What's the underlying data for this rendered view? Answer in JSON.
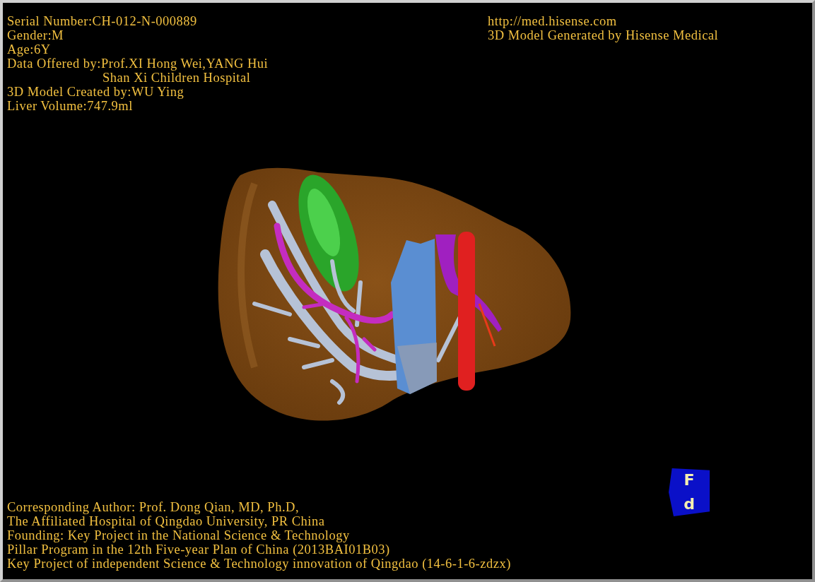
{
  "info_left": [
    {
      "kind": "line",
      "text": "Serial Number:CH-012-N-000889"
    },
    {
      "kind": "line",
      "text": "Gender:M"
    },
    {
      "kind": "line",
      "text": "Age:6Y"
    },
    {
      "kind": "line",
      "text": "Data Offered by:Prof.XI Hong Wei,YANG Hui"
    },
    {
      "kind": "continuation",
      "text": "Shan Xi Children Hospital"
    },
    {
      "kind": "line",
      "text": "3D Model Created by:WU Ying"
    },
    {
      "kind": "line",
      "text": "Liver Volume:747.9ml"
    }
  ],
  "info_right": [
    "http://med.hisense.com",
    "3D Model Generated by Hisense Medical"
  ],
  "orientation_cube": {
    "faces": [
      "F",
      "d"
    ]
  },
  "credits": [
    "Corresponding Author: Prof. Dong Qian, MD, Ph.D,",
    "The Affiliated Hospital of Qingdao University, PR China",
    "Founding: Key Project in the National Science & Technology",
    "Pillar Program in the 12th Five-year Plan of China (2013BAI01B03)",
    "Key Project of independent Science & Technology innovation of Qingdao (14-6-1-6-zdzx)"
  ]
}
